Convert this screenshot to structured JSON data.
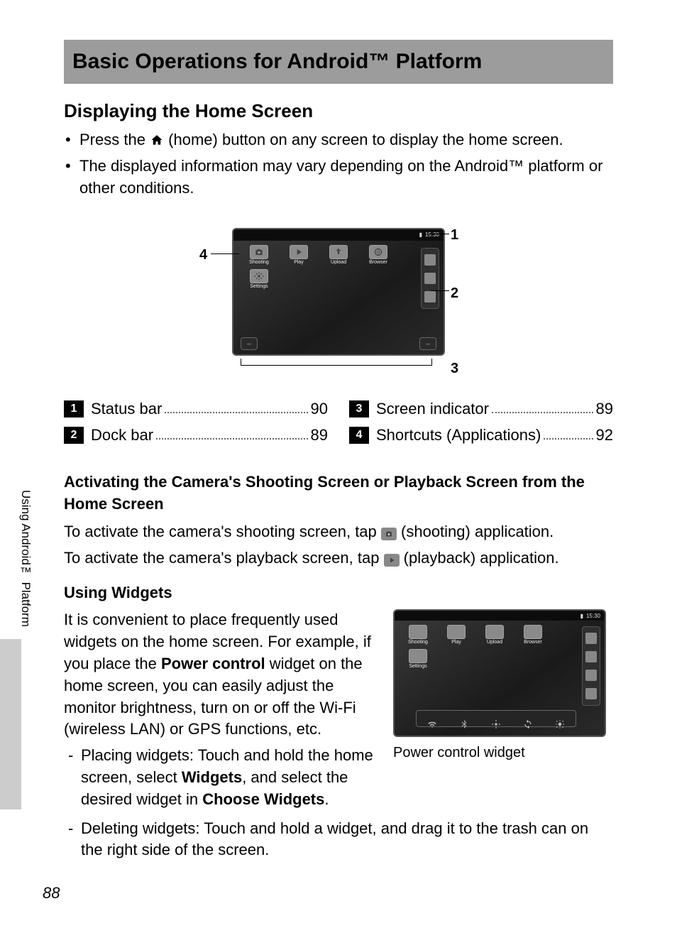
{
  "page_title": "Basic Operations for Android™ Platform",
  "section1": {
    "heading": "Displaying the Home Screen",
    "bullet1a": "Press the ",
    "bullet1b": " (home) button on any screen to display the home screen.",
    "bullet2": "The displayed information may vary depending on the Android™ platform or other conditions."
  },
  "device": {
    "time": "15:30",
    "apps": {
      "shooting": "Shooting",
      "play": "Play",
      "upload": "Upload",
      "browser": "Browser",
      "settings": "Settings"
    },
    "handle": "↔"
  },
  "callouts": {
    "n1": "1",
    "n2": "2",
    "n3": "3",
    "n4": "4"
  },
  "legend": {
    "r1": {
      "num": "1",
      "label": "Status bar",
      "page": "90"
    },
    "r2": {
      "num": "2",
      "label": "Dock bar",
      "page": "89"
    },
    "r3": {
      "num": "3",
      "label": "Screen indicator",
      "page": "89"
    },
    "r4": {
      "num": "4",
      "label": "Shortcuts (Applications)",
      "page": "92"
    }
  },
  "section2": {
    "heading": "Activating the Camera's Shooting Screen or Playback Screen from the Home Screen",
    "p1a": "To activate the camera's shooting screen, tap ",
    "p1b": " (shooting) application.",
    "p2a": "To activate the camera's playback screen, tap ",
    "p2b": " (playback) application."
  },
  "section3": {
    "heading": "Using Widgets",
    "intro_a": "It is convenient to place frequently used widgets on the home screen. For example, if you place the ",
    "intro_bold1": "Power control",
    "intro_b": " widget on the home screen, you can easily adjust the monitor brightness, turn on or off the Wi-Fi (wireless LAN) or GPS functions, etc.",
    "li1_a": "Placing widgets: Touch and hold the home screen, select ",
    "li1_bold1": "Widgets",
    "li1_b": ", and select the desired widget in ",
    "li1_bold2": "Choose Widgets",
    "li1_c": ".",
    "li2": "Deleting widgets: Touch and hold a widget, and drag it to the trash can on the right side of the screen.",
    "caption": "Power control widget"
  },
  "side_tab": "Using Android™ Platform",
  "page_number": "88"
}
